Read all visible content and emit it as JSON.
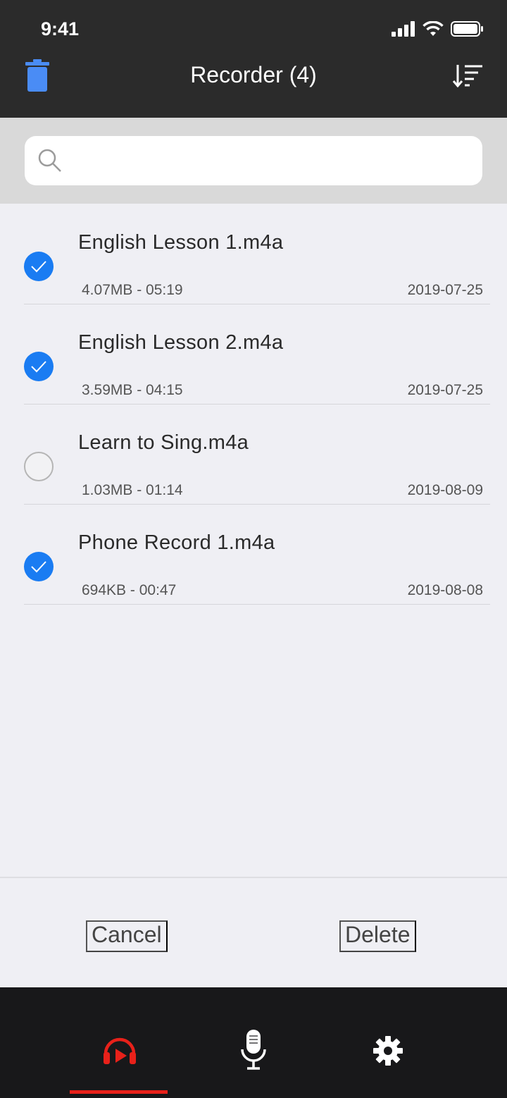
{
  "status": {
    "time": "9:41"
  },
  "nav": {
    "title": "Recorder (4)"
  },
  "search": {
    "value": "",
    "placeholder": ""
  },
  "recordings": [
    {
      "name": "English Lesson 1.m4a",
      "meta": "4.07MB - 05:19",
      "date": "2019-07-25",
      "selected": true
    },
    {
      "name": "English Lesson 2.m4a",
      "meta": "3.59MB - 04:15",
      "date": "2019-07-25",
      "selected": true
    },
    {
      "name": "Learn to Sing.m4a",
      "meta": "1.03MB - 01:14",
      "date": "2019-08-09",
      "selected": false
    },
    {
      "name": "Phone Record 1.m4a",
      "meta": "694KB - 00:47",
      "date": "2019-08-08",
      "selected": true
    }
  ],
  "actions": {
    "cancel_label": "Cancel",
    "delete_label": "Delete"
  },
  "tabs": [
    {
      "icon": "headphones-play-icon",
      "active": true
    },
    {
      "icon": "microphone-icon",
      "active": false
    },
    {
      "icon": "gear-icon",
      "active": false
    }
  ],
  "colors": {
    "accent": "#1a7cf2",
    "trash": "#4a8cf5",
    "active_tab": "#e8211a",
    "header": "#2b2b2b",
    "tab_bar": "#18181a"
  }
}
